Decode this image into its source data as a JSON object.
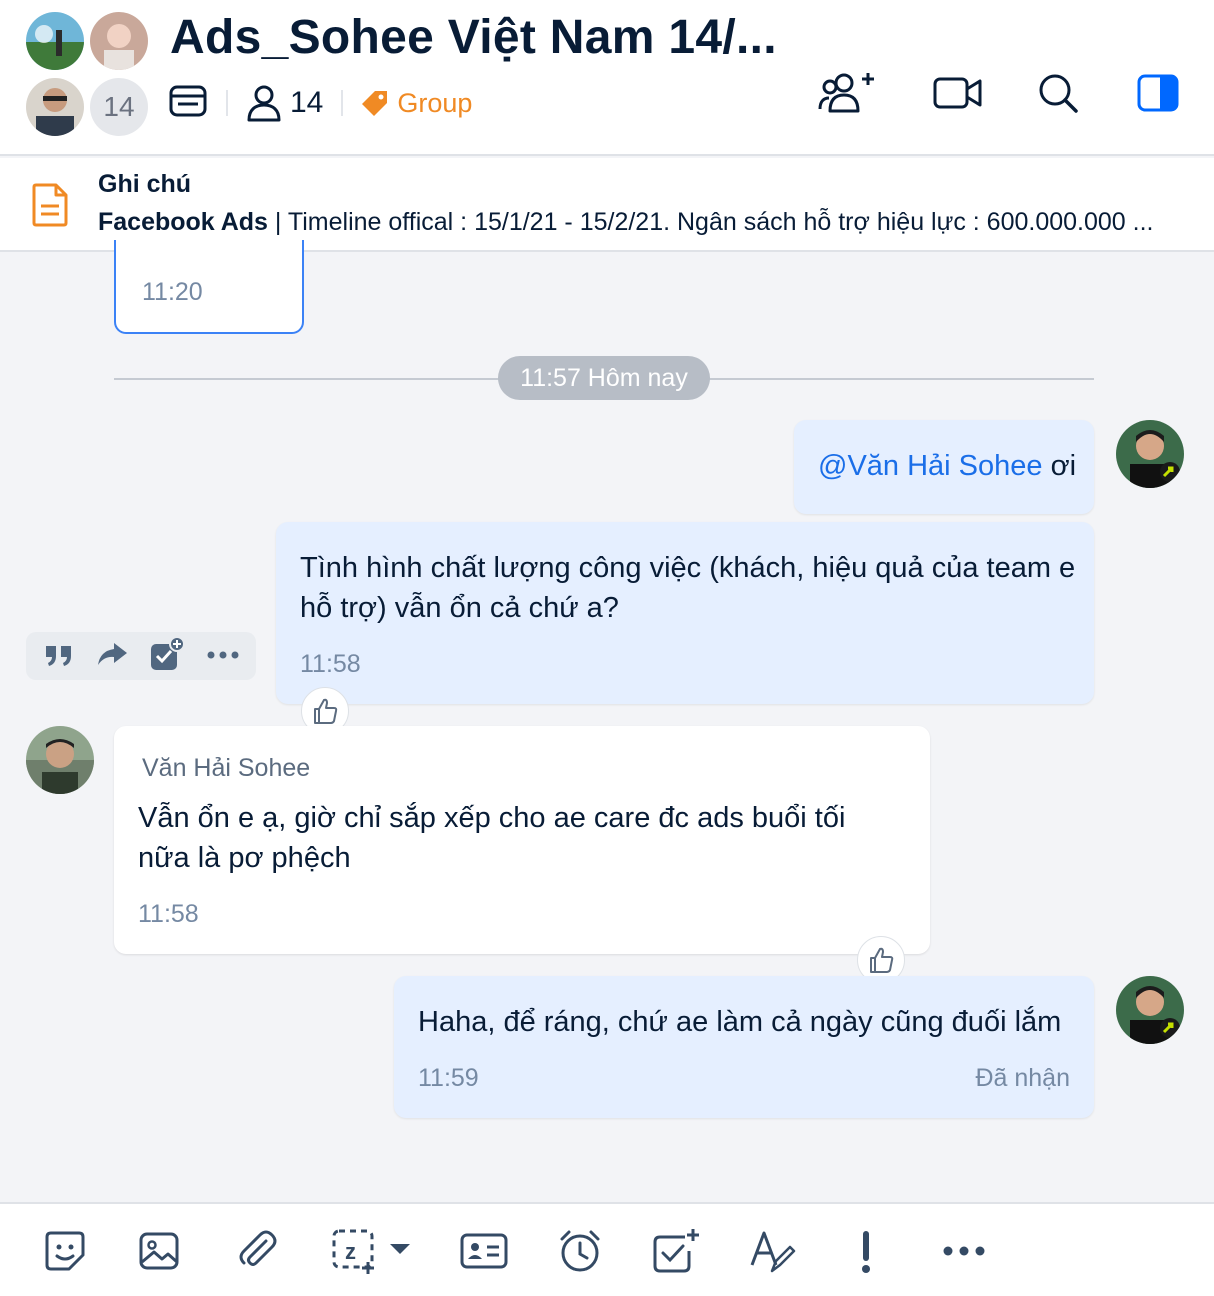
{
  "header": {
    "title": "Ads_Sohee Việt Nam 14/...",
    "member_count_badge": "14",
    "members": "14",
    "tag": "Group",
    "accent": "#0068ff",
    "tag_color": "#f08a24"
  },
  "pinned": {
    "title": "Ghi chú",
    "bold_prefix": "Facebook Ads",
    "text": " | Timeline offical : 15/1/21 - 15/2/21. Ngân sách hỗ trợ hiệu lực : 600.000.000 ..."
  },
  "chat": {
    "prev_time": "11:20",
    "divider": "11:57 Hôm nay",
    "messages": [
      {
        "mention": "@Văn Hải Sohee",
        "text": " ơi"
      },
      {
        "text": "Tình hình chất lượng công việc (khách, hiệu quả của team e hỗ trợ) vẫn ổn cả chứ a?",
        "time": "11:58"
      },
      {
        "sender": "Văn Hải Sohee",
        "text": "Vẫn ổn e ạ, giờ chỉ sắp xếp cho ae care đc ads buổi tối nữa là pơ phệch",
        "time": "11:58"
      },
      {
        "text": "Haha, để ráng, chứ ae làm cả ngày cũng đuối lắm",
        "time": "11:59",
        "status": "Đã nhận"
      }
    ]
  },
  "icons": {
    "header": [
      "add-member-icon",
      "video-call-icon",
      "search-icon",
      "sidebar-toggle-icon"
    ],
    "actions": [
      "quote-icon",
      "forward-icon",
      "create-task-icon",
      "more-icon"
    ],
    "toolbar": [
      "sticker-icon",
      "image-icon",
      "attachment-icon",
      "screenshot-icon",
      "contact-card-icon",
      "reminder-icon",
      "todo-icon",
      "text-format-icon",
      "urgent-icon",
      "more-icon"
    ]
  }
}
